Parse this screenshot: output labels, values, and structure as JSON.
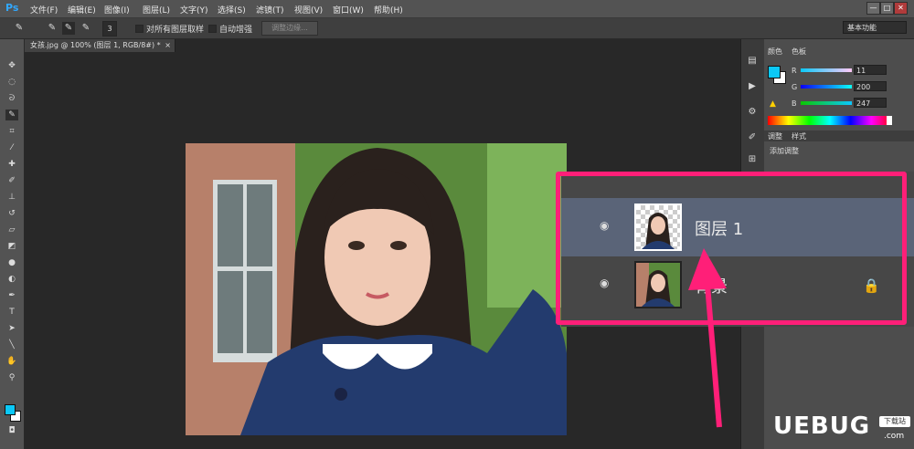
{
  "app": {
    "logo": "Ps",
    "menus": [
      "文件(F)",
      "编辑(E)",
      "图像(I)",
      "图层(L)",
      "文字(Y)",
      "选择(S)",
      "滤镜(T)",
      "视图(V)",
      "窗口(W)",
      "帮助(H)"
    ],
    "window_buttons": [
      "—",
      "□",
      "✕"
    ]
  },
  "options_bar": {
    "brush_size": "3",
    "sample_all_layers": "对所有图层取样",
    "auto_enhance": "自动增强",
    "refine_edge": "调整边缘...",
    "workspace": "基本功能"
  },
  "document": {
    "tab_title": "女孩.jpg @ 100% (图层 1, RGB/8#) *",
    "tab_close": "×"
  },
  "color_panel": {
    "tabs": [
      "颜色",
      "色板"
    ],
    "channels": [
      {
        "label": "R",
        "value": "11",
        "gradient": "#ff8ff0"
      },
      {
        "label": "G",
        "value": "200",
        "gradient": "#3a7ff7"
      },
      {
        "label": "B",
        "value": "247",
        "gradient": "#11c800"
      }
    ],
    "foreground": "#0bc8f7",
    "background": "#ffffff"
  },
  "adjustments_panel": {
    "tabs": [
      "调整",
      "样式"
    ],
    "label": "添加调整"
  },
  "layers_zoom": {
    "layers": [
      {
        "name": "图层 1",
        "selected": true,
        "transparent": true
      },
      {
        "name": "背景",
        "selected": false,
        "locked": true
      }
    ]
  },
  "annotation": {
    "color": "#ff1f78"
  },
  "watermark": {
    "text": "UEBUG",
    "sub": "下载站",
    "domain": ".com"
  }
}
